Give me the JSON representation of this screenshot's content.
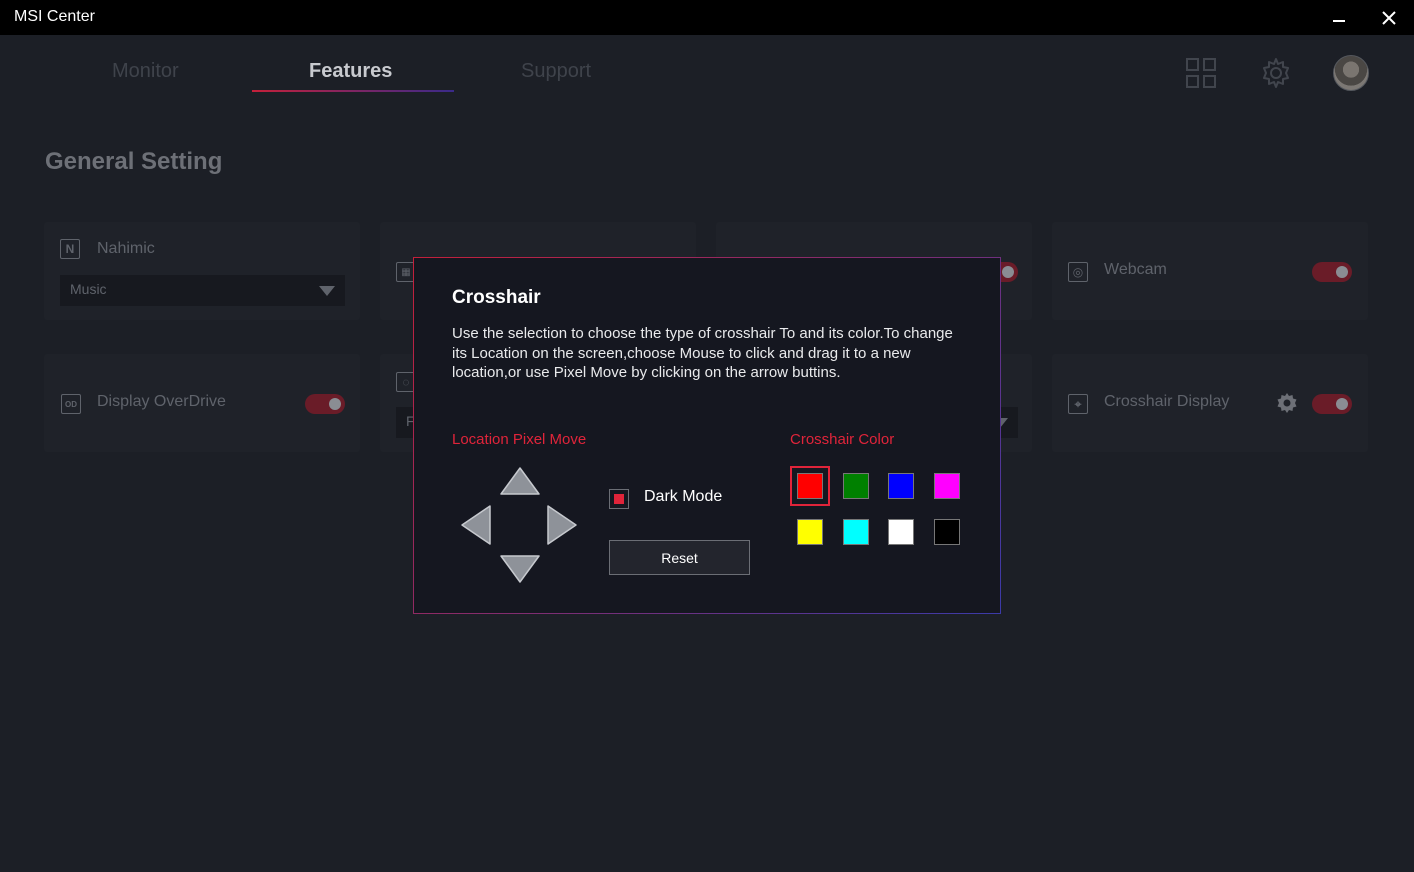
{
  "window": {
    "title": "MSI Center",
    "minimize_glyph": "–",
    "close_glyph": "✕"
  },
  "header": {
    "tabs": [
      {
        "label": "Monitor"
      },
      {
        "label": "Features"
      },
      {
        "label": "Support"
      }
    ],
    "active_tab": "Features",
    "icons": [
      "grid-icon",
      "gear-icon",
      "avatar"
    ]
  },
  "main": {
    "section_title": "General Setting",
    "cards": {
      "nahimic": {
        "label": "Nahimic",
        "icon_glyph": "N",
        "dropdown_value": "Music"
      },
      "display_overdrive": {
        "label": "Display OverDrive",
        "icon_glyph": "OD",
        "toggle_on": true
      },
      "webcam": {
        "label": "Webcam",
        "icon_glyph": "◎",
        "toggle_on": true
      },
      "crosshair_display": {
        "label": "Crosshair Display",
        "icon_glyph": "⌖",
        "toggle_on": true
      },
      "partial_dropdown_text": "F"
    }
  },
  "modal": {
    "title": "Crosshair",
    "description": "Use the selection to choose the type of crosshair To and its color.To change its Location on the screen,choose Mouse to click and drag it to a new location,or use Pixel Move by clicking on the arrow buttins.",
    "location_label": "Location Pixel Move",
    "color_label": "Crosshair Color",
    "dark_mode_label": "Dark Mode",
    "dark_mode_checked": true,
    "reset_label": "Reset",
    "colors": [
      "#ff0000",
      "#008000",
      "#0000ff",
      "#ff00ff",
      "#ffff00",
      "#00ffff",
      "#ffffff",
      "#000000"
    ],
    "selected_color": "#ff0000",
    "accent_color": "#e0243a"
  }
}
